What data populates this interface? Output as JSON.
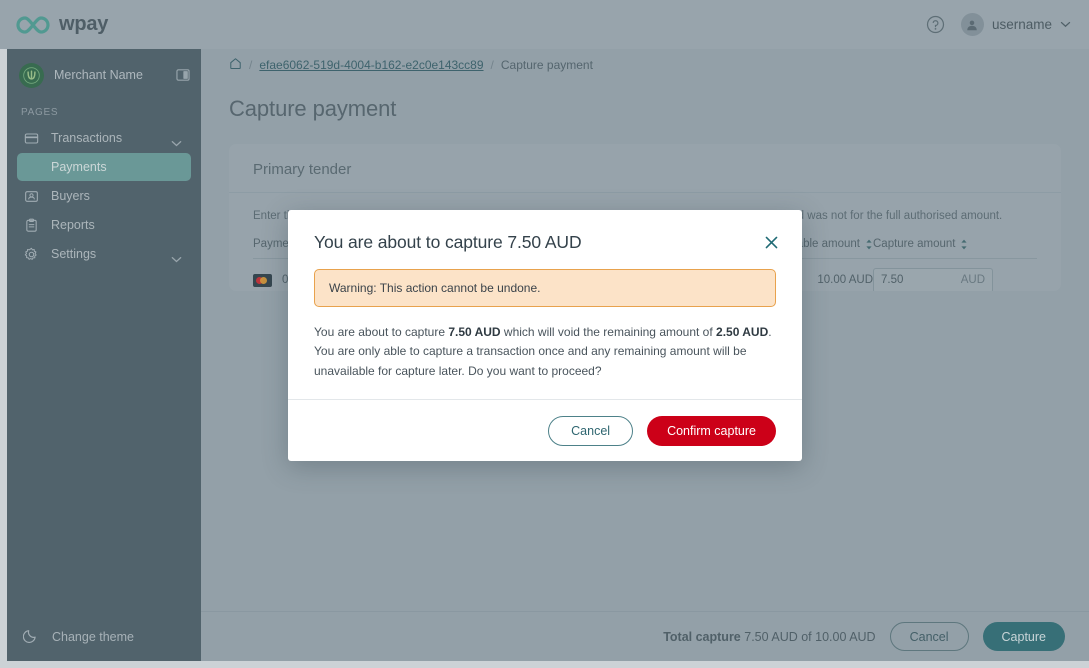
{
  "topbar": {
    "brand_name": "wpay",
    "brand_logo_icon": "infinity-logo-icon",
    "help_icon": "help-circle-icon",
    "avatar_icon": "user-avatar-icon",
    "user_name": "username",
    "chevron_icon": "chevron-down-icon"
  },
  "sidebar": {
    "merchant_name": "Merchant Name",
    "merchant_avatar_icon": "woolworths-logo-icon",
    "collapse_icon": "sidebar-collapse-icon",
    "section_label": "PAGES",
    "items": [
      {
        "label": "Transactions",
        "icon": "credit-card-icon",
        "expandable": true,
        "active": false,
        "sub": false
      },
      {
        "label": "Payments",
        "icon": "",
        "expandable": false,
        "active": true,
        "sub": true
      },
      {
        "label": "Buyers",
        "icon": "id-card-icon",
        "expandable": false,
        "active": false,
        "sub": false
      },
      {
        "label": "Reports",
        "icon": "clipboard-icon",
        "expandable": false,
        "active": false,
        "sub": false
      },
      {
        "label": "Settings",
        "icon": "gear-icon",
        "expandable": true,
        "active": false,
        "sub": false
      }
    ],
    "theme_label": "Change theme",
    "theme_icon": "moon-icon"
  },
  "breadcrumb": {
    "home_icon": "home-icon",
    "separator": "/",
    "link_text": "efae6062-519d-4004-b162-e2c0e143cc89",
    "current": "Capture payment"
  },
  "page": {
    "title": "Capture payment"
  },
  "card": {
    "title": "Primary tender",
    "description": "Enter the amount you want to capture. You can only capture a transaction once, even if the amount captured was not for the full authorised amount.",
    "table": {
      "columns": [
        {
          "label": "Payment",
          "sortable": false
        },
        {
          "label": "",
          "sortable": false
        },
        {
          "label": "Available amount",
          "sortable": true
        },
        {
          "label": "Capture amount",
          "sortable": true
        }
      ],
      "sort_icon": "sort-updown-icon",
      "row": {
        "card_brand_icon": "mastercard-icon",
        "payment_ref": "000",
        "available_amount": "10.00 AUD",
        "capture_amount_value": "7.50",
        "capture_amount_currency": "AUD"
      }
    }
  },
  "footer": {
    "total_label": "Total capture",
    "total_value": "7.50 AUD of 10.00 AUD",
    "cancel_label": "Cancel",
    "capture_label": "Capture"
  },
  "modal": {
    "title": "You are about to capture 7.50 AUD",
    "close_icon": "close-icon",
    "warning": "Warning: This action cannot be undone.",
    "body_part1": "You are about to capture ",
    "body_bold1": "7.50 AUD",
    "body_part2": " which will void the remaining amount of ",
    "body_bold2": "2.50 AUD",
    "body_part3": ". You are only able to capture a transaction once and any remaining amount will be unavailable for capture later. Do you want to proceed?",
    "cancel_label": "Cancel",
    "confirm_label": "Confirm capture"
  },
  "colors": {
    "brand_teal": "#4fa699",
    "sidebar_bg": "#4f6069",
    "active_nav": "#6fa5a0",
    "danger_red": "#cc0018",
    "warning_bg": "#fce3c8",
    "warning_border": "#e8a24d",
    "teal_button": "#2e7078"
  }
}
